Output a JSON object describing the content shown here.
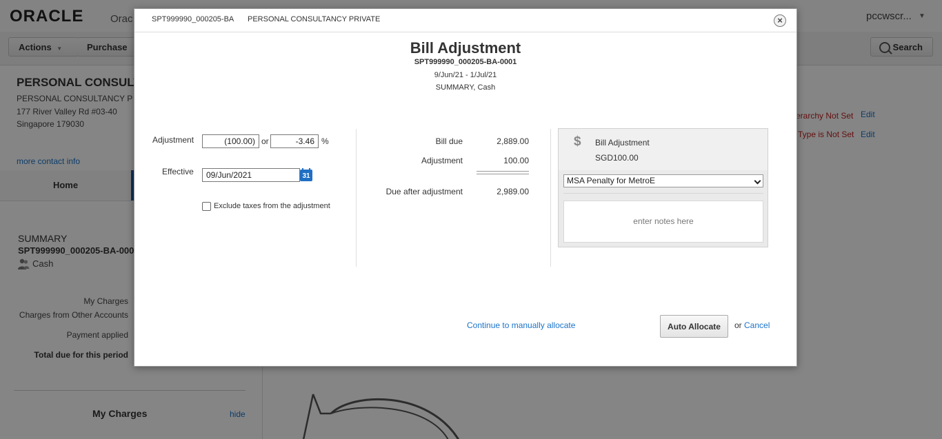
{
  "app": {
    "logo": "ORACLE",
    "logo_sub": "Orac",
    "user": "pccwscr...",
    "toolbar": {
      "actions": "Actions",
      "purchase": "Purchase",
      "search": "Search"
    },
    "account": {
      "name": "PERSONAL CONSULT",
      "address_lines": [
        "PERSONAL CONSULTANCY P",
        "177 River Valley Rd #03-40",
        "Singapore 179030"
      ],
      "more_contact": "more contact info"
    },
    "warnings": [
      {
        "text": "erarchy Not Set",
        "edit": "Edit"
      },
      {
        "text": "Type is Not Set",
        "edit": "Edit"
      }
    ],
    "home_tab": "Home",
    "summary": {
      "title": "SUMMARY",
      "id": "SPT999990_000205-BA-000",
      "payment": "Cash",
      "rows": [
        "My Charges",
        "Charges from Other Accounts",
        "Payment applied",
        "Total due for this period"
      ]
    },
    "my_charges": {
      "title": "My Charges",
      "hide": "hide"
    }
  },
  "modal": {
    "header_id": "SPT999990_000205-BA",
    "header_name": "PERSONAL CONSULTANCY PRIVATE",
    "close_glyph": "×",
    "title": "Bill Adjustment",
    "bill_id": "SPT999990_000205-BA-0001",
    "period": "9/Jun/21 - 1/Jul/21",
    "type": "SUMMARY, Cash",
    "form": {
      "adjustment_label": "Adjustment",
      "adjustment_value": "(100.00)",
      "or_text": "or",
      "percent_value": "-3.46",
      "percent_sign": "%",
      "effective_label": "Effective",
      "effective_value": "09/Jun/2021",
      "calendar_day": "31",
      "exclude_taxes": "Exclude taxes from the adjustment"
    },
    "summary": {
      "bill_due_label": "Bill due",
      "bill_due": "2,889.00",
      "adjustment_label": "Adjustment",
      "adjustment": "100.00",
      "due_after_label": "Due after adjustment",
      "due_after": "2,989.00"
    },
    "side": {
      "title": "Bill Adjustment",
      "amount": "SGD100.00",
      "reason": "MSA Penalty for MetroE",
      "notes_placeholder": "enter notes here"
    },
    "footer": {
      "continue": "Continue to manually allocate",
      "auto_allocate": "Auto Allocate",
      "or_text": "or",
      "cancel": "Cancel"
    }
  }
}
